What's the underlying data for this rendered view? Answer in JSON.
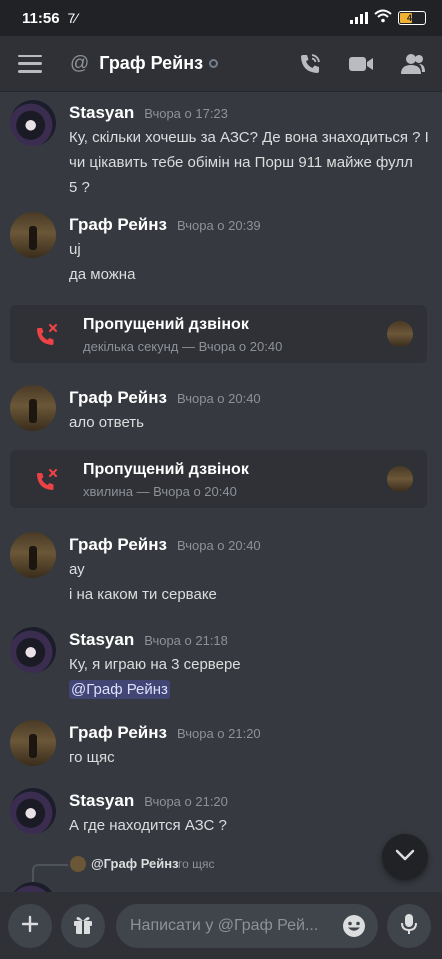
{
  "status_bar": {
    "time": "11:56",
    "app_indicator": "7⁄",
    "battery": "47"
  },
  "header": {
    "at_symbol": "@",
    "title": "Граф Рейнз",
    "icons": [
      "hamburger-icon",
      "voice-call-icon",
      "video-call-icon",
      "members-icon"
    ]
  },
  "messages": [
    {
      "author": "Stasyan",
      "time": "Вчора о 17:23",
      "lines": [
        "Ку, скільки хочешь за АЗС? Де вона знаходиться ? І",
        "чи цікавить тебе обімін на Порш 911 майже фулл",
        "5 ?"
      ]
    },
    {
      "author": "Граф Рейнз",
      "time": "Вчора о 20:39",
      "lines": [
        "uj",
        "да можна"
      ]
    },
    {
      "type": "missed_call",
      "title": "Пропущений дзвінок",
      "sub": "декілька секунд — Вчора о 20:40"
    },
    {
      "author": "Граф Рейнз",
      "time": "Вчора о 20:40",
      "lines": [
        "ало ответь"
      ]
    },
    {
      "type": "missed_call",
      "title": "Пропущений дзвінок",
      "sub": "хвилина — Вчора о 20:40"
    },
    {
      "author": "Граф Рейнз",
      "time": "Вчора о 20:40",
      "lines": [
        "ау",
        "і на каком ти серваке"
      ]
    },
    {
      "author": "Stasyan",
      "time": "Вчора о 21:18",
      "lines": [
        "Ку, я играю на 3 сервере"
      ],
      "mention": "@Граф Рейнз"
    },
    {
      "author": "Граф Рейнз",
      "time": "Вчора о 21:20",
      "lines": [
        "го щяс"
      ]
    },
    {
      "author": "Stasyan",
      "time": "Вчора о 21:20",
      "lines": [
        "А где находится АЗС ?"
      ]
    }
  ],
  "reply_preview": {
    "name": "@Граф Рейнз",
    "time": "го щяс"
  },
  "input": {
    "placeholder": "Написати у @Граф Рей..."
  },
  "colors": {
    "background": "#36393f",
    "header": "#2f3136",
    "missed_call": "#ed4245",
    "mention_bg": "#414675"
  }
}
